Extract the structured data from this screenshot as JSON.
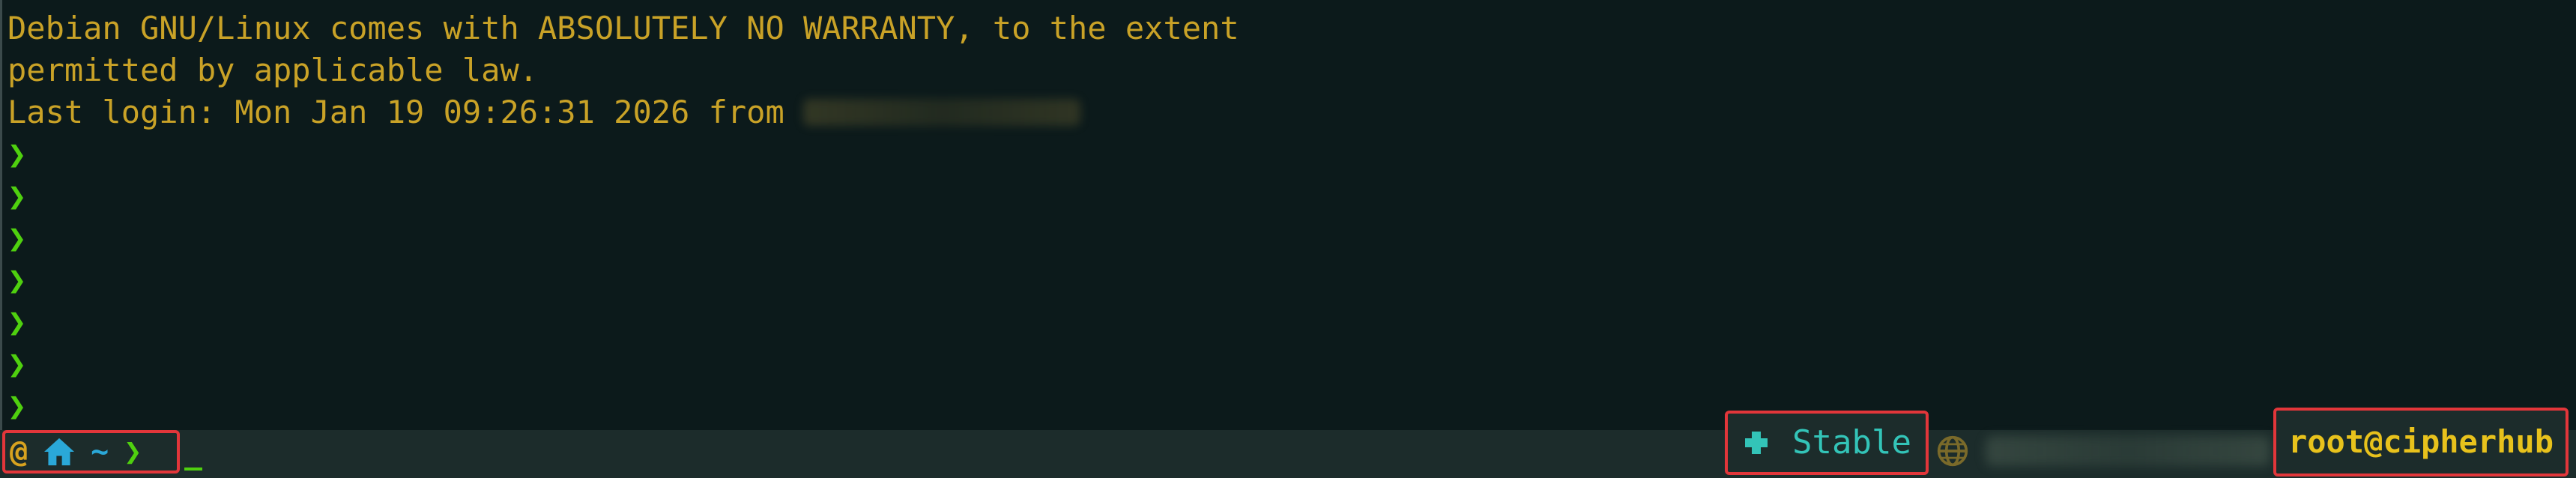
{
  "terminal": {
    "motd_lines": [
      "Debian GNU/Linux comes with ABSOLUTELY NO WARRANTY, to the extent",
      "permitted by applicable law."
    ],
    "last_login_prefix": "Last login: Mon Jan 19 09:26:31 2026 from",
    "prompt_glyph": "❯",
    "empty_prompt_count": 7
  },
  "statusbar": {
    "left": {
      "os_icon": "debian-swirl-icon",
      "home_icon": "home-icon",
      "path": "~",
      "prompt_glyph": "❯"
    },
    "stable": {
      "icon": "puzzle-icon",
      "label": "Stable"
    },
    "network": {
      "icon": "globe-icon"
    },
    "user": {
      "label": "root@cipherhub"
    }
  },
  "colors": {
    "background": "#0c1a1b",
    "text": "#c9a227",
    "prompt": "#4fd00f",
    "accent_cyan": "#33c4b8",
    "accent_blue": "#2aa8d8",
    "highlight_border": "#e2363a",
    "user": "#e8c21c"
  }
}
